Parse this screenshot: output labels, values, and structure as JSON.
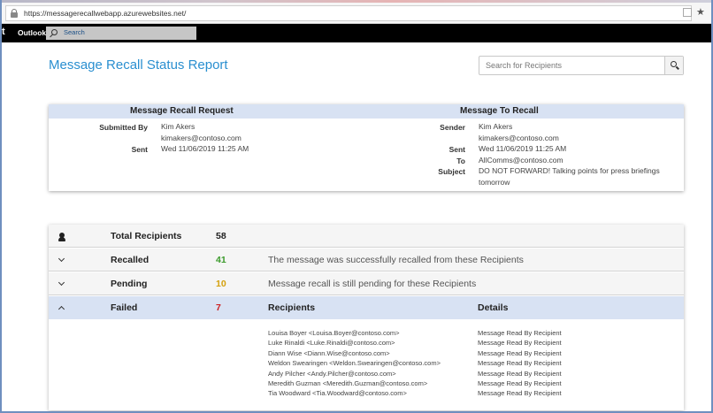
{
  "browser": {
    "url": "https://messagerecallwebapp.azurewebsites.net/",
    "star_glyph": "★"
  },
  "outlook_bar": {
    "letter": "t",
    "app_name": "Outlook",
    "search_label": "Search"
  },
  "page": {
    "title": "Message Recall Status Report",
    "search_placeholder": "Search for Recipients"
  },
  "request": {
    "heading": "Message Recall Request",
    "submitted_by_label": "Submitted By",
    "submitted_by_name": "Kim Akers",
    "submitted_by_email": "kimakers@contoso.com",
    "sent_label": "Sent",
    "sent_value": "Wed 11/06/2019 11:25 AM"
  },
  "message": {
    "heading": "Message To Recall",
    "sender_label": "Sender",
    "sender_name": "Kim Akers",
    "sender_email": "kimakers@contoso.com",
    "sent_label": "Sent",
    "sent_value": "Wed 11/06/2019 11:25 AM",
    "to_label": "To",
    "to_value": "AllComms@contoso.com",
    "subject_label": "Subject",
    "subject_line1": "DO NOT FORWARD! Talking points for press briefings",
    "subject_line2": "tomorrow"
  },
  "summary": {
    "total": {
      "label": "Total Recipients",
      "count": "58",
      "icon": "person-icon"
    },
    "recalled": {
      "label": "Recalled",
      "count": "41",
      "description": "The message was successfully recalled from these Recipients",
      "color": "#3a9a2a"
    },
    "pending": {
      "label": "Pending",
      "count": "10",
      "description": "Message recall is still pending for these Recipients",
      "color": "#d4a00c"
    },
    "failed": {
      "label": "Failed",
      "count": "7",
      "color": "#cc1f1f",
      "col_recipients": "Recipients",
      "col_details": "Details"
    }
  },
  "failed_recipients": [
    {
      "recipient": "Louisa Boyer <Louisa.Boyer@contoso.com>",
      "detail": "Message Read By Recipient"
    },
    {
      "recipient": "Luke Rinaldi <Luke.Rinaldi@contoso.com>",
      "detail": "Message Read By Recipient"
    },
    {
      "recipient": "Diann Wise <Diann.Wise@contoso.com>",
      "detail": "Message Read By Recipient"
    },
    {
      "recipient": "Weldon Swearingen <Weldon.Swearingen@contoso.com>",
      "detail": "Message Read By Recipient"
    },
    {
      "recipient": "Andy Pilcher <Andy.Pilcher@contoso.com>",
      "detail": "Message Read By Recipient"
    },
    {
      "recipient": "Meredith Guzman <Meredith.Guzman@contoso.com>",
      "detail": "Message Read By Recipient"
    },
    {
      "recipient": "Tia Woodward <Tia.Woodward@contoso.com>",
      "detail": "Message Read By Recipient"
    }
  ]
}
